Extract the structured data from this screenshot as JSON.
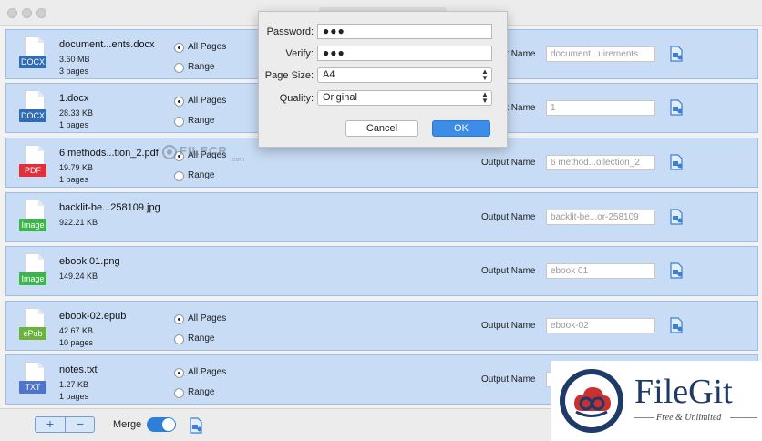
{
  "window": {
    "title": ""
  },
  "colors": {
    "row_bg": "#c8dcf5",
    "accent": "#3d8de8",
    "docx": "#2f6cb3",
    "pdf": "#e0313a",
    "image": "#3eb54a",
    "epub": "#6cb33e",
    "txt": "#4f74c9"
  },
  "files": [
    {
      "name": "document...ents.docx",
      "ext": "DOCX",
      "ext_color": "#2f6cb3",
      "size": "3.60 MB",
      "pages": "3 pages",
      "opt_all": "All Pages",
      "opt_range": "Range",
      "output_label": "Output Name",
      "output_value": "document...uirements",
      "has_radio": true
    },
    {
      "name": "1.docx",
      "ext": "DOCX",
      "ext_color": "#2f6cb3",
      "size": "28.33 KB",
      "pages": "1 pages",
      "opt_all": "All Pages",
      "opt_range": "Range",
      "output_label": "Output Name",
      "output_value": "1",
      "has_radio": true
    },
    {
      "name": "6 methods...tion_2.pdf",
      "ext": "PDF",
      "ext_color": "#e0313a",
      "size": "19.79 KB",
      "pages": "1 pages",
      "opt_all": "All Pages",
      "opt_range": "Range",
      "output_label": "Output Name",
      "output_value": "6 method...ollection_2",
      "has_radio": true
    },
    {
      "name": "backlit-be...258109.jpg",
      "ext": "Image",
      "ext_color": "#3eb54a",
      "size": "922.21 KB",
      "pages": "",
      "opt_all": "",
      "opt_range": "",
      "output_label": "Output Name",
      "output_value": "backlit-be...or-258109",
      "has_radio": false
    },
    {
      "name": "ebook 01.png",
      "ext": "Image",
      "ext_color": "#3eb54a",
      "size": "149.24 KB",
      "pages": "",
      "opt_all": "",
      "opt_range": "",
      "output_label": "Output Name",
      "output_value": "ebook 01",
      "has_radio": false
    },
    {
      "name": "ebook-02.epub",
      "ext": "ePub",
      "ext_color": "#6cb33e",
      "size": "42.67 KB",
      "pages": "10 pages",
      "opt_all": "All Pages",
      "opt_range": "Range",
      "output_label": "Output Name",
      "output_value": "ebook-02",
      "has_radio": true
    },
    {
      "name": "notes.txt",
      "ext": "TXT",
      "ext_color": "#4f74c9",
      "size": "1.27 KB",
      "pages": "1 pages",
      "opt_all": "All Pages",
      "opt_range": "Range",
      "output_label": "Output Name",
      "output_value": "",
      "has_radio": true
    }
  ],
  "dialog": {
    "password_label": "Password:",
    "password_value": "●●●",
    "verify_label": "Verify:",
    "verify_value": "●●●",
    "pagesize_label": "Page Size:",
    "pagesize_value": "A4",
    "quality_label": "Quality:",
    "quality_value": "Original",
    "cancel_label": "Cancel",
    "ok_label": "OK"
  },
  "bottom": {
    "add_label": "+",
    "remove_label": "−",
    "merge_label": "Merge",
    "merge_on": true
  },
  "watermark": {
    "text": "FILECR",
    "sub": ".com"
  },
  "filegit": {
    "name": "FileGit",
    "tagline": "Free & Unlimited"
  }
}
